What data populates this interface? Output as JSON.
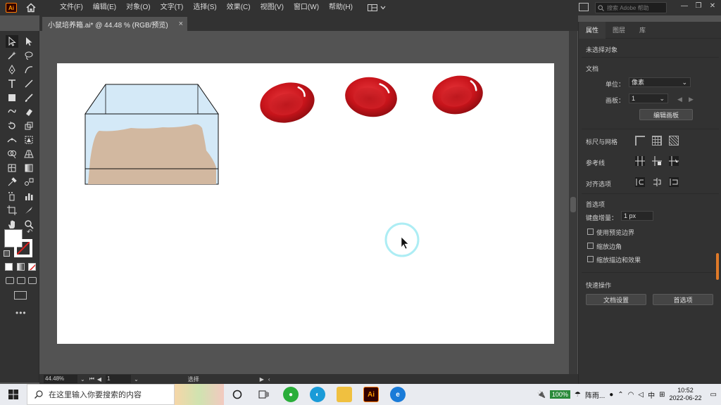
{
  "menubar": {
    "app_logo": "Ai",
    "menus": [
      "文件(F)",
      "编辑(E)",
      "对象(O)",
      "文字(T)",
      "选择(S)",
      "效果(C)",
      "视图(V)",
      "窗口(W)",
      "帮助(H)"
    ],
    "search_placeholder": "搜索 Adobe 帮助"
  },
  "document_tab": {
    "title": "小鼠培养箱.ai* @ 44.48 % (RGB/预览)",
    "close": "×"
  },
  "statusbar": {
    "zoom": "44.48%",
    "artboard": "1",
    "tool_name": "选择"
  },
  "right_panel": {
    "tabs": [
      "属性",
      "图层",
      "库"
    ],
    "no_selection": "未选择对象",
    "document_section": "文档",
    "units_label": "单位：",
    "units_value": "像素",
    "artboard_label": "画板：",
    "artboard_value": "1",
    "edit_artboards_button": "编辑画板",
    "rulers_grid_label": "标尺与网格",
    "guides_label": "参考线",
    "align_options_label": "对齐选项",
    "preferences_section": "首选项",
    "keyboard_increment_label": "键盘增量：",
    "keyboard_increment_value": "1 px",
    "checkbox_preview_bounds": "使用预览边界",
    "checkbox_scale_corners": "缩放边角",
    "checkbox_scale_strokes": "缩放描边和效果",
    "quick_actions_section": "快速操作",
    "doc_setup_button": "文档设置",
    "preferences_button": "首选项"
  },
  "taskbar": {
    "search_placeholder": "在这里输入你要搜索的内容",
    "battery": "100%",
    "weather": "阵雨...",
    "ime": "中",
    "time": "10:52",
    "date": "2022-06-22"
  },
  "colors": {
    "accent_orange": "#ff7c00",
    "blood_cell_red": "#c8141b",
    "bedding_tan": "#d2b8a0",
    "tank_blue": "#d4e9f7"
  }
}
